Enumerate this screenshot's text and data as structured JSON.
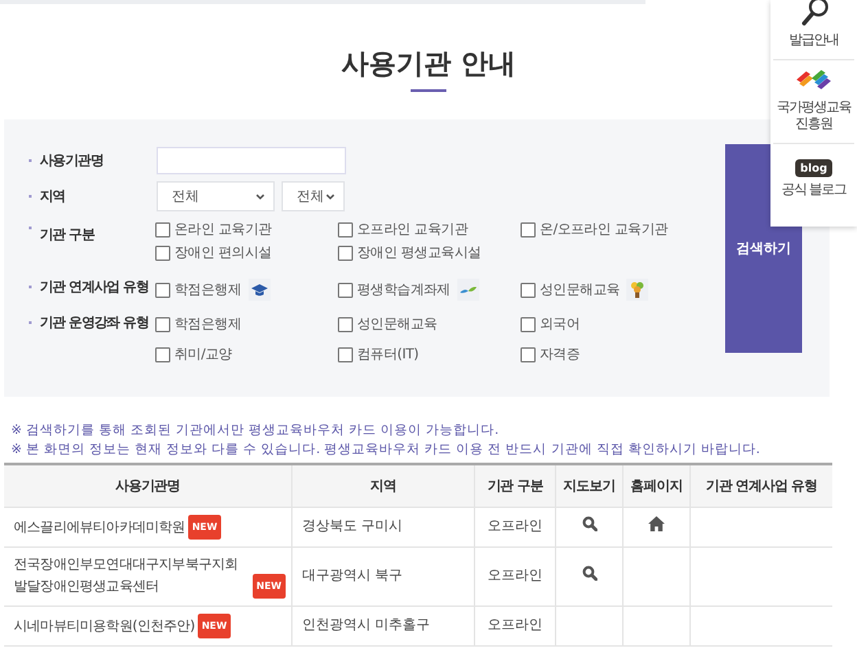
{
  "title": "사용기관 안내",
  "search": {
    "name_label": "사용기관명",
    "region_label": "지역",
    "region_selects": [
      "전체",
      "전체"
    ],
    "groups": [
      {
        "label": "기관 구분",
        "kind": "compact",
        "options": [
          {
            "label": "온라인 교육기관",
            "checked": false
          },
          {
            "label": "오프라인 교육기관",
            "checked": false
          },
          {
            "label": "온/오프라인 교육기관",
            "checked": false
          },
          {
            "label": "장애인 편의시설",
            "checked": false
          },
          {
            "label": "장애인 평생교육시설",
            "checked": false
          }
        ]
      },
      {
        "label": "기관 연계사업 유형",
        "kind": "with_icons",
        "options": [
          {
            "label": "학점은행제",
            "checked": false
          },
          {
            "label": "평생학습계좌제",
            "checked": false
          },
          {
            "label": "성인문해교육",
            "checked": false
          }
        ]
      },
      {
        "label": "기관 운영강좌 유형",
        "kind": "spaced",
        "options": [
          {
            "label": "학점은행제",
            "checked": false
          },
          {
            "label": "성인문해교육",
            "checked": false
          },
          {
            "label": "외국어",
            "checked": false
          },
          {
            "label": "취미/교양",
            "checked": false
          },
          {
            "label": "컴퓨터(IT)",
            "checked": false
          },
          {
            "label": "자격증",
            "checked": false
          }
        ]
      }
    ],
    "button": "검색하기"
  },
  "notes": [
    "※ 검색하기를 통해 조회된 기관에서만 평생교육바우처 카드 이용이 가능합니다.",
    "※ 본 화면의 정보는 현재 정보와 다를 수 있습니다. 평생교육바우처 카드 이용 전 반드시 기관에 직접 확인하시기 바랍니다."
  ],
  "table": {
    "columns": [
      "사용기관명",
      "지역",
      "기관 구분",
      "지도보기",
      "홈페이지",
      "기관 연계사업 유형"
    ],
    "rows": [
      {
        "name": "에스끌리에뷰티아카데미학원",
        "badge": "NEW",
        "region": "경상북도 구미시",
        "type": "오프라인",
        "map": true,
        "homepage": true
      },
      {
        "name": "전국장애인부모연대대구지부북구지회발달장애인평생교육센터",
        "badge": "NEW",
        "region": "대구광역시 북구",
        "type": "오프라인",
        "map": true,
        "homepage": false
      },
      {
        "name": "시네마뷰티미용학원(인천주안)",
        "badge": "NEW",
        "region": "인천광역시 미추홀구",
        "type": "오프라인",
        "map": false,
        "homepage": false
      }
    ]
  },
  "side_panel": [
    {
      "kind": "guide",
      "label": "발급안내"
    },
    {
      "kind": "logo",
      "label": "국가평생교육\n진흥원"
    },
    {
      "kind": "blog",
      "label": "공식 블로그",
      "icon_text": "blog"
    }
  ]
}
